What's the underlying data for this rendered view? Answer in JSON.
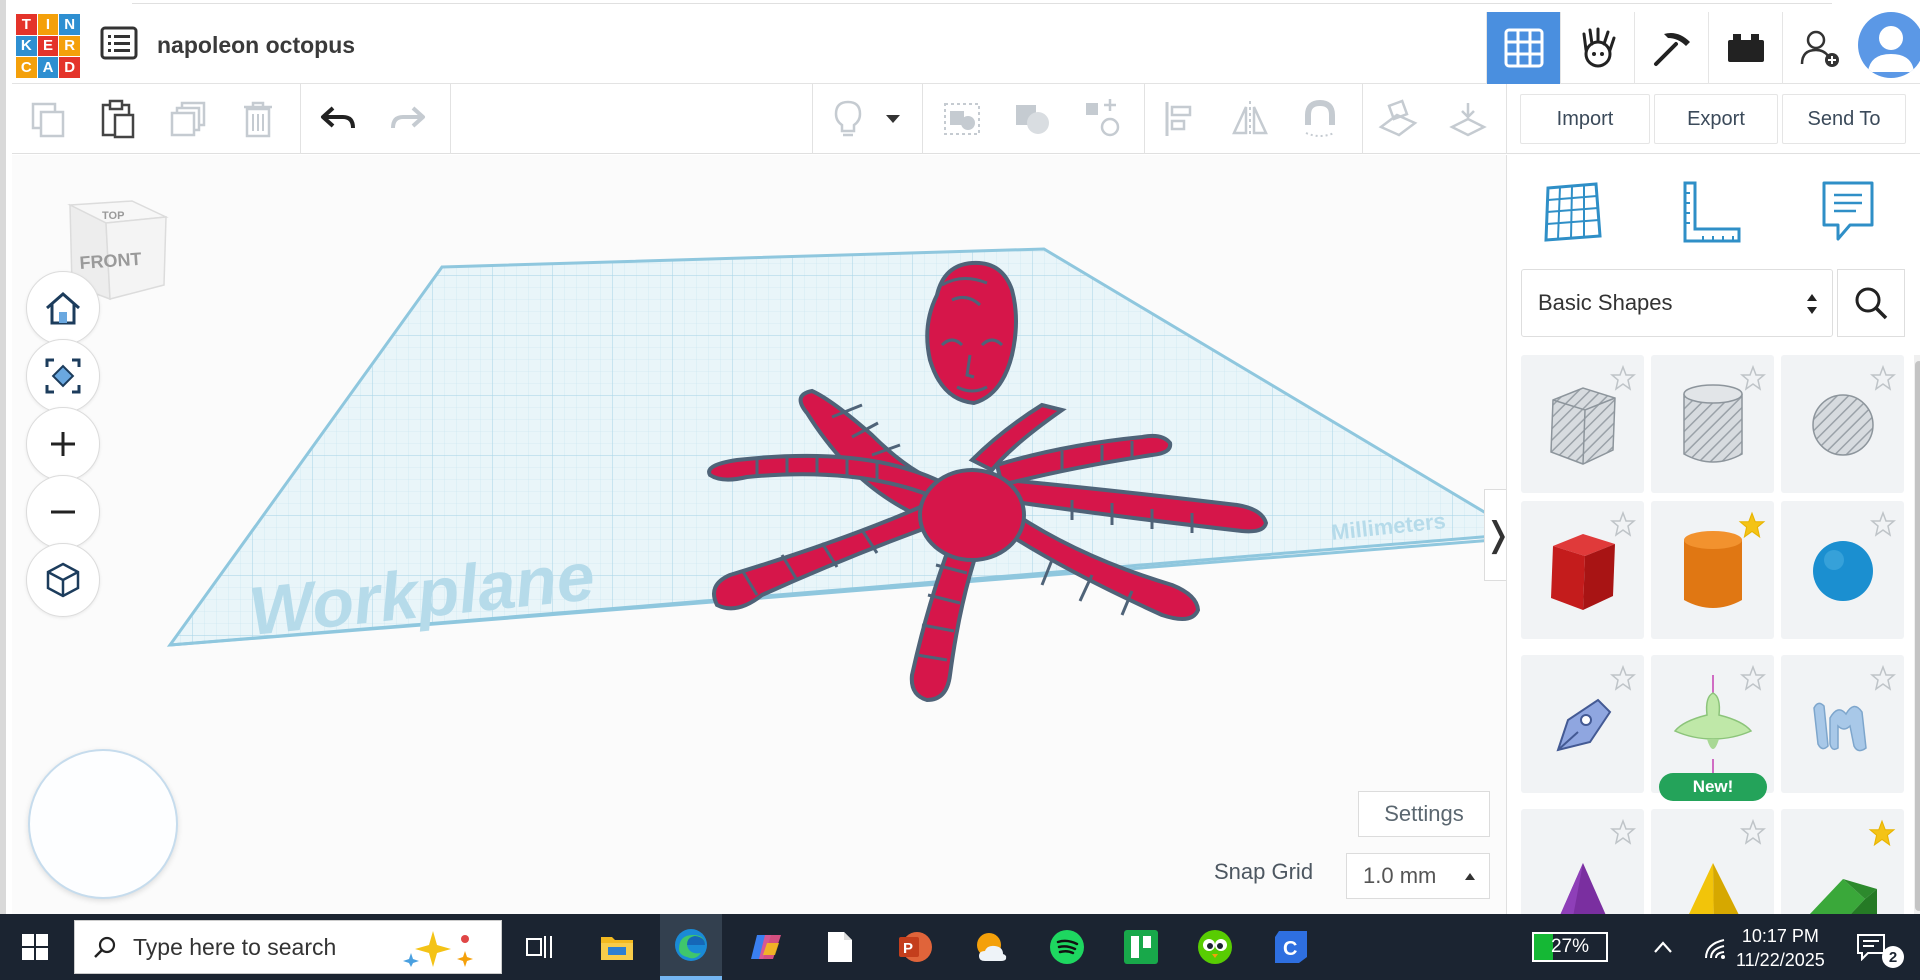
{
  "app": {
    "logo_letters": [
      "T",
      "I",
      "N",
      "K",
      "E",
      "R",
      "C",
      "A",
      "D"
    ],
    "design_title": "napoleon octopus"
  },
  "toolbar": {
    "import_label": "Import",
    "export_label": "Export",
    "send_to_label": "Send To"
  },
  "canvas": {
    "viewcube_top": "TOP",
    "viewcube_front": "FRONT",
    "workplane_label": "Workplane",
    "units_label": "Millimeters",
    "settings_label": "Settings",
    "snap_grid_label": "Snap Grid",
    "snap_grid_value": "1.0 mm"
  },
  "panel": {
    "shape_category": "Basic Shapes",
    "new_badge": "New!",
    "shapes": [
      {
        "name": "Box (hole)",
        "favorite": false
      },
      {
        "name": "Cylinder (hole)",
        "favorite": false
      },
      {
        "name": "Sphere (hole)",
        "favorite": false
      },
      {
        "name": "Box",
        "favorite": false
      },
      {
        "name": "Cylinder",
        "favorite": true
      },
      {
        "name": "Sphere",
        "favorite": false
      },
      {
        "name": "Scribble",
        "favorite": false
      },
      {
        "name": "Revolver",
        "favorite": false,
        "is_new": true
      },
      {
        "name": "Text",
        "favorite": false
      },
      {
        "name": "Cone",
        "favorite": false
      },
      {
        "name": "Pyramid",
        "favorite": false
      },
      {
        "name": "Roof",
        "favorite": true
      }
    ]
  },
  "taskbar": {
    "search_placeholder": "Type here to search",
    "battery": "27%",
    "time": "10:17 PM",
    "date": "11/22/2025",
    "notifications": "2"
  },
  "colors": {
    "accent": "#4a8fdf",
    "octopus": "#d6164a",
    "workplane": "#e8f4f8",
    "taskbar": "#1b2431"
  }
}
